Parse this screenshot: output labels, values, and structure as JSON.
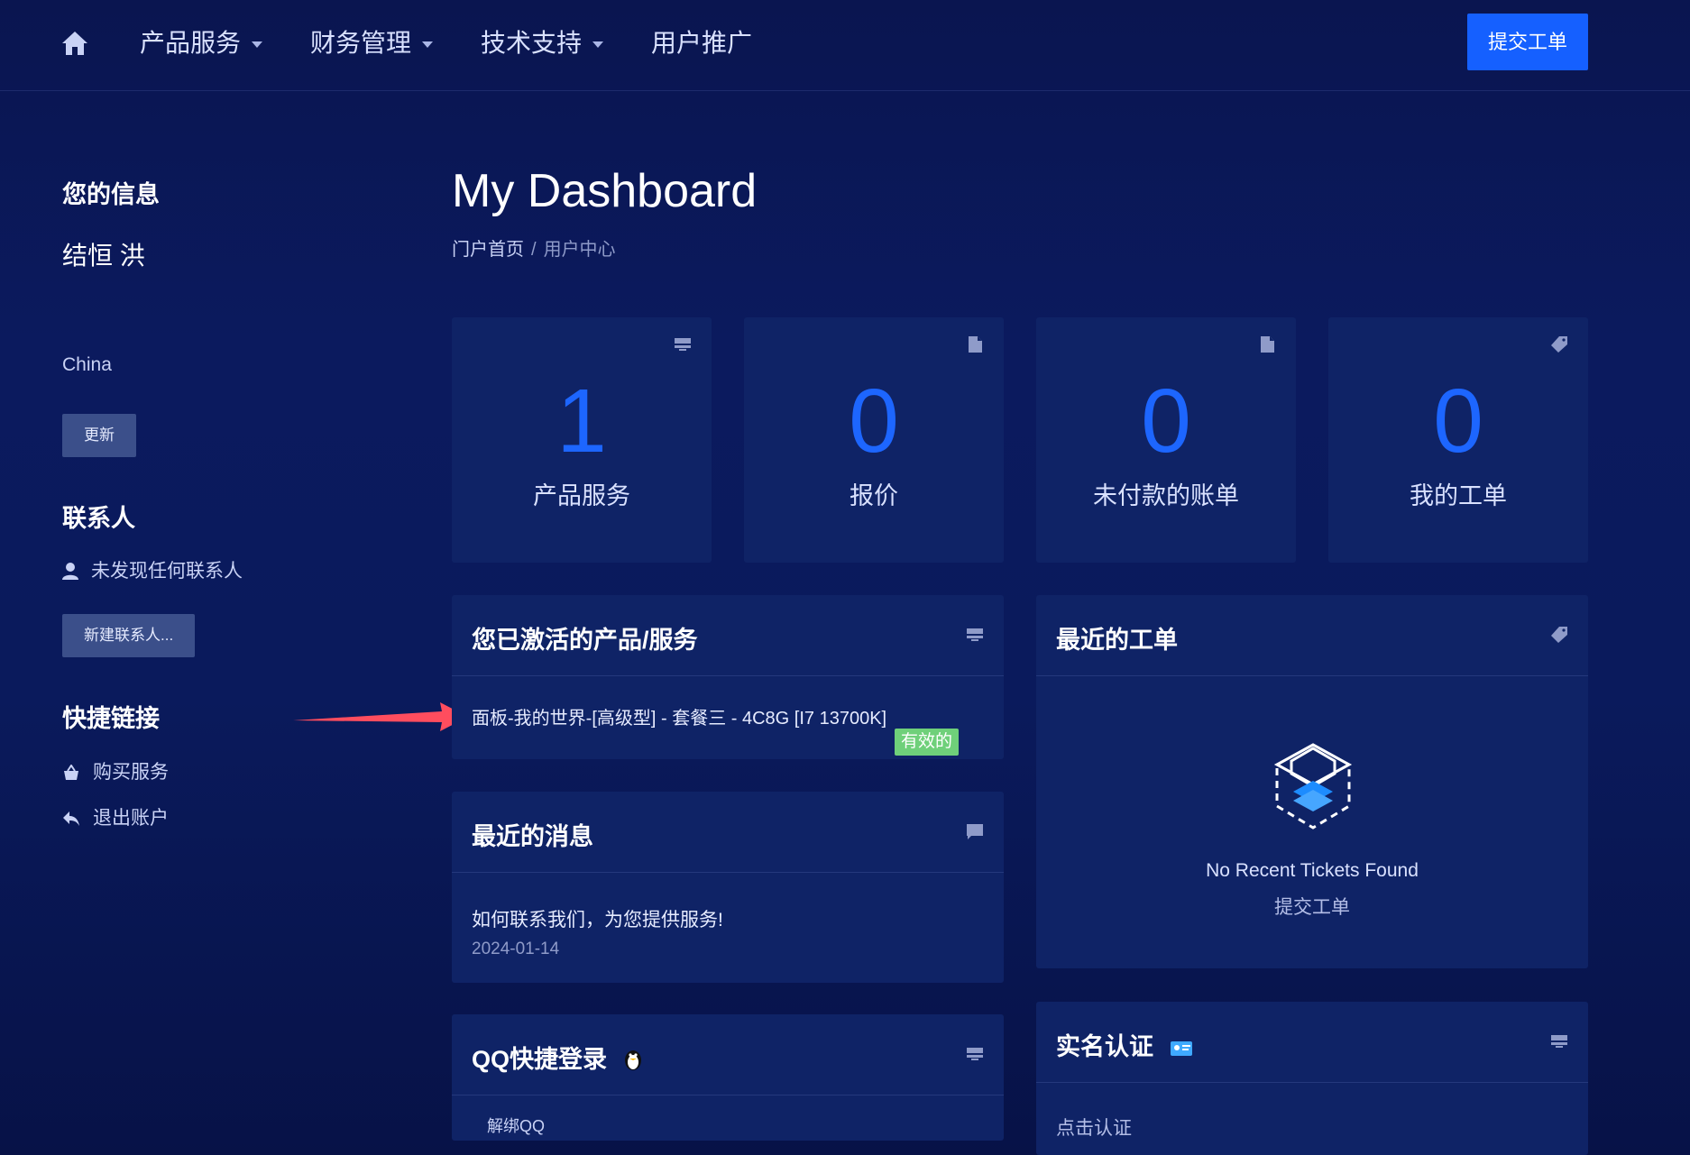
{
  "nav": {
    "items": [
      {
        "label": "产品服务"
      },
      {
        "label": "财务管理"
      },
      {
        "label": "技术支持"
      },
      {
        "label": "用户推广"
      }
    ],
    "submit_ticket": "提交工单"
  },
  "sidebar": {
    "info_heading": "您的信息",
    "user_name": "结恒 洪",
    "country": "China",
    "update_button": "更新",
    "contacts_heading": "联系人",
    "no_contacts": "未发现任何联系人",
    "new_contact_button": "新建联系人...",
    "shortcuts_heading": "快捷链接",
    "shortcuts": [
      {
        "label": "购买服务",
        "icon": "basket-icon"
      },
      {
        "label": "退出账户",
        "icon": "reply-arrow-icon"
      }
    ]
  },
  "main": {
    "title": "My Dashboard",
    "breadcrumb": {
      "home": "门户首页",
      "separator": "/",
      "current": "用户中心"
    },
    "tiles": [
      {
        "value": "1",
        "label": "产品服务",
        "icon": "server-icon"
      },
      {
        "value": "0",
        "label": "报价",
        "icon": "document-icon"
      },
      {
        "value": "0",
        "label": "未付款的账单",
        "icon": "document-icon"
      },
      {
        "value": "0",
        "label": "我的工单",
        "icon": "tag-icon"
      }
    ],
    "services_panel": {
      "title": "您已激活的产品/服务",
      "item": "面板-我的世界-[高级型] - 套餐三 - 4C8G [I7 13700K]",
      "status": "有效的"
    },
    "tickets_panel": {
      "title": "最近的工单",
      "empty": "No Recent Tickets Found",
      "action": "提交工单"
    },
    "news_panel": {
      "title": "最近的消息",
      "item": "如何联系我们，为您提供服务!",
      "date": "2024-01-14"
    },
    "qq_panel": {
      "title": "QQ快捷登录",
      "unbind": "解绑QQ"
    },
    "verify_panel": {
      "title": "实名认证",
      "action": "点击认证"
    }
  },
  "colors": {
    "accent": "#1560ff",
    "tile_number": "#1d66ff",
    "panel_bg": "#0f2366",
    "status_active": "#6fd07a",
    "arrow": "#ff4d5e"
  }
}
